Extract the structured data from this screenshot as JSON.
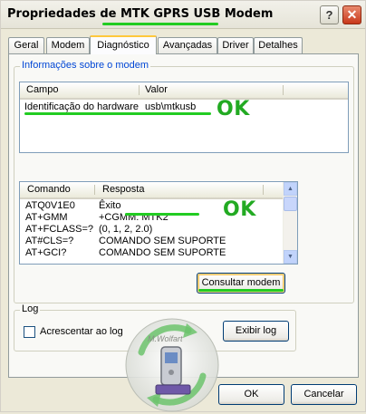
{
  "window": {
    "title": "Propriedades de MTK GPRS USB Modem",
    "help_label": "?",
    "close_label": "✕"
  },
  "tabs": [
    {
      "label": "Geral"
    },
    {
      "label": "Modem"
    },
    {
      "label": "Diagnóstico",
      "active": true
    },
    {
      "label": "Avançadas"
    },
    {
      "label": "Driver"
    },
    {
      "label": "Detalhes"
    }
  ],
  "modem_info": {
    "group_title": "Informações sobre o modem",
    "columns": [
      "Campo",
      "Valor"
    ],
    "rows": [
      {
        "field": "Identificação do hardware",
        "value": "usb\\mtkusb"
      }
    ],
    "annotation": "OK"
  },
  "responses": {
    "columns": [
      "Comando",
      "Resposta"
    ],
    "rows": [
      {
        "command": "ATQ0V1E0",
        "response": "Êxito"
      },
      {
        "command": "AT+GMM",
        "response": "+CGMM: MTK2"
      },
      {
        "command": "AT+FCLASS=?",
        "response": "(0, 1, 2, 2.0)"
      },
      {
        "command": "AT#CLS=?",
        "response": "COMANDO SEM SUPORTE"
      },
      {
        "command": "AT+GCI?",
        "response": "COMANDO SEM SUPORTE"
      }
    ],
    "annotation": "OK",
    "query_button": "Consultar modem"
  },
  "log": {
    "group_title": "Log",
    "append_label": "Acrescentar ao log",
    "append_checked": false,
    "view_button": "Exibir log"
  },
  "watermark_text": "M.Wolfart",
  "footer": {
    "ok_label": "OK",
    "cancel_label": "Cancelar"
  },
  "colors": {
    "annotation_green": "#22cc22",
    "group_title_blue": "#0046d5"
  }
}
